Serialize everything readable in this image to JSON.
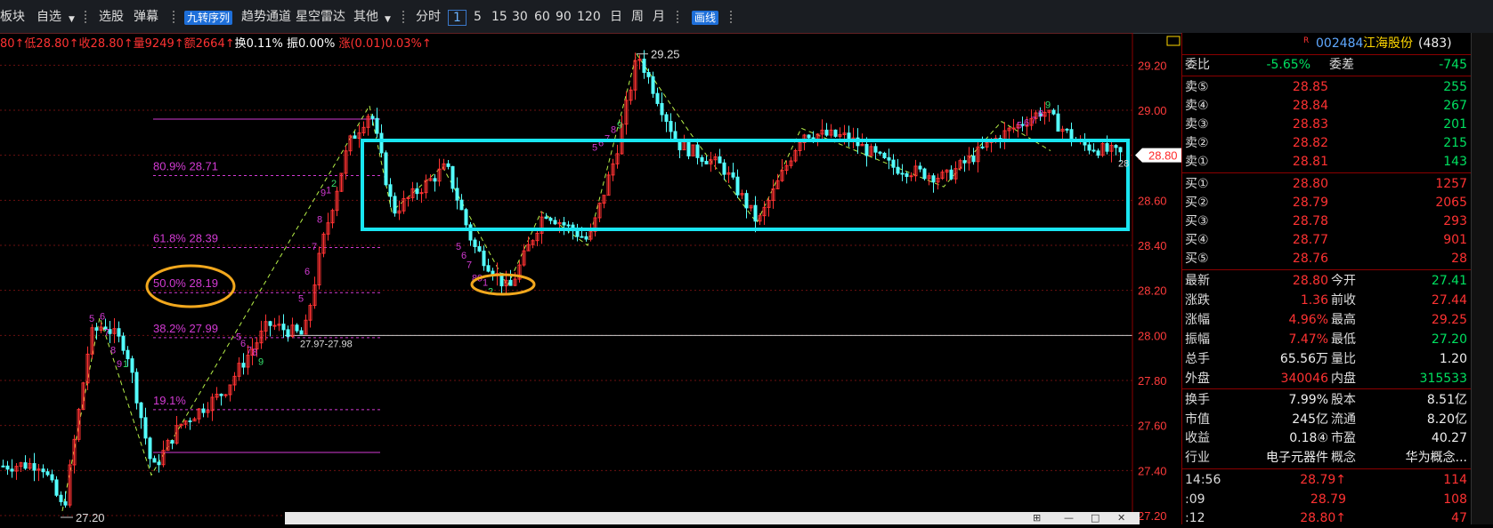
{
  "toolbar": {
    "items": [
      "板块",
      "自选",
      "选股",
      "弹幕",
      "九转序列",
      "趋势通道",
      "星空雷达",
      "其他",
      "分时",
      "1",
      "5",
      "15",
      "30",
      "60",
      "90",
      "120",
      "日",
      "周",
      "月",
      "画线"
    ]
  },
  "infobar": {
    "parts": [
      {
        "text": "80↑低28.80↑收28.80↑量9249↑额2664↑",
        "color": "#ff3232"
      },
      {
        "text": "换0.11% 振0.00% ",
        "color": "#ffffff"
      },
      {
        "text": "涨(0.01)0.03%↑",
        "color": "#ff3232"
      }
    ]
  },
  "chart_data": {
    "type": "candlestick",
    "y_ticks": [
      "29.20",
      "29.00",
      "28.80",
      "28.60",
      "28.40",
      "28.20",
      "28.00",
      "27.80",
      "27.60",
      "27.40",
      "27.20"
    ],
    "ylim": [
      27.2,
      29.3
    ],
    "annotations": {
      "high": "29.25",
      "low": "27.20",
      "range_label": "27.97-27.98",
      "current": "28.80",
      "right_partial": "28"
    },
    "fib_levels": [
      {
        "label": "80.9% 28.71",
        "value": 28.71
      },
      {
        "label": "61.8% 28.39",
        "value": 28.39
      },
      {
        "label": "50.0% 28.19",
        "value": 28.19
      },
      {
        "label": "38.2% 27.99",
        "value": 27.99
      },
      {
        "label": "19.1%",
        "value": 27.67
      }
    ],
    "nine_turn_marks": [
      "3",
      "4",
      "5",
      "6",
      "7",
      "8",
      "9",
      "1",
      "2"
    ]
  },
  "panel": {
    "code": "002484",
    "name": "江海股份",
    "count": "(483)",
    "weibi_label": "委比",
    "weibi": "-5.65%",
    "weicha_label": "委差",
    "weicha": "-745",
    "sell": [
      {
        "label": "卖⑤",
        "price": "28.85",
        "vol": "255"
      },
      {
        "label": "卖④",
        "price": "28.84",
        "vol": "267"
      },
      {
        "label": "卖③",
        "price": "28.83",
        "vol": "201"
      },
      {
        "label": "卖②",
        "price": "28.82",
        "vol": "215"
      },
      {
        "label": "卖①",
        "price": "28.81",
        "vol": "143"
      }
    ],
    "buy": [
      {
        "label": "买①",
        "price": "28.80",
        "vol": "1257"
      },
      {
        "label": "买②",
        "price": "28.79",
        "vol": "2065"
      },
      {
        "label": "买③",
        "price": "28.78",
        "vol": "293"
      },
      {
        "label": "买④",
        "price": "28.77",
        "vol": "901"
      },
      {
        "label": "买⑤",
        "price": "28.76",
        "vol": "28"
      }
    ],
    "quote": [
      {
        "l1": "最新",
        "v1": "28.80",
        "l2": "今开",
        "v2": "27.41"
      },
      {
        "l1": "涨跌",
        "v1": "1.36",
        "l2": "前收",
        "v2": "27.44"
      },
      {
        "l1": "涨幅",
        "v1": "4.96%",
        "l2": "最高",
        "v2": "29.25"
      },
      {
        "l1": "振幅",
        "v1": "7.47%",
        "l2": "最低",
        "v2": "27.20"
      },
      {
        "l1": "总手",
        "v1": "65.56万",
        "l2": "量比",
        "v2": "1.20"
      },
      {
        "l1": "外盘",
        "v1": "340046",
        "l2": "内盘",
        "v2": "315533"
      }
    ],
    "fund": [
      {
        "l1": "换手",
        "v1": "7.99%",
        "l2": "股本",
        "v2": "8.51亿"
      },
      {
        "l1": "市值",
        "v1": "245亿",
        "l2": "流通",
        "v2": "8.20亿"
      },
      {
        "l1": "收益",
        "v1": "0.18④",
        "l2": "市盈",
        "v2": "40.27"
      },
      {
        "l1": "行业",
        "v1": "电子元器件",
        "l2": "概念",
        "v2": "华为概念..."
      }
    ],
    "ticks": [
      {
        "t": "14:56",
        "p": "28.79↑",
        "v": "114"
      },
      {
        "t": ":09",
        "p": "28.79",
        "v": "108"
      },
      {
        "t": ":12",
        "p": "28.80↑",
        "v": "47"
      }
    ],
    "current_tag": "28.80"
  }
}
